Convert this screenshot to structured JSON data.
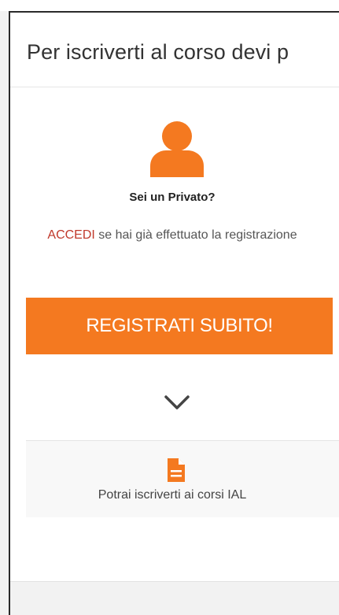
{
  "modal": {
    "title": "Per iscriverti al corso devi p",
    "private": {
      "icon": "person-icon",
      "question": "Sei un Privato?",
      "login_link": "ACCEDI",
      "login_rest": " se hai già effettuato la registrazione"
    },
    "register_button": "REGISTRATI SUBITO!",
    "expand_icon": "chevron-down-icon",
    "info": {
      "icon": "document-icon",
      "text": "Potrai iscriverti ai corsi IAL"
    }
  },
  "colors": {
    "accent": "#f47920",
    "link": "#c0392b",
    "text": "#333333"
  }
}
